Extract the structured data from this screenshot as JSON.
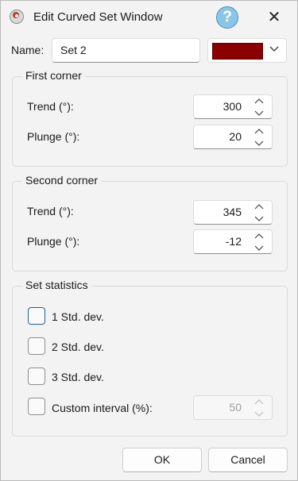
{
  "window": {
    "title": "Edit Curved Set Window"
  },
  "titlebar": {
    "help_label": "?",
    "close_label": "✕"
  },
  "name": {
    "label": "Name:",
    "value": "Set 2"
  },
  "color": {
    "value": "#8b0000"
  },
  "first_corner": {
    "title": "First corner",
    "trend_label": "Trend (°):",
    "trend_value": "300",
    "plunge_label": "Plunge (°):",
    "plunge_value": "20"
  },
  "second_corner": {
    "title": "Second corner",
    "trend_label": "Trend (°):",
    "trend_value": "345",
    "plunge_label": "Plunge (°):",
    "plunge_value": "-12"
  },
  "set_statistics": {
    "title": "Set statistics",
    "std1_label": "1 Std. dev.",
    "std2_label": "2 Std. dev.",
    "std3_label": "3 Std. dev.",
    "custom_label": "Custom interval (%):",
    "custom_value": "50"
  },
  "buttons": {
    "ok": "OK",
    "cancel": "Cancel"
  }
}
